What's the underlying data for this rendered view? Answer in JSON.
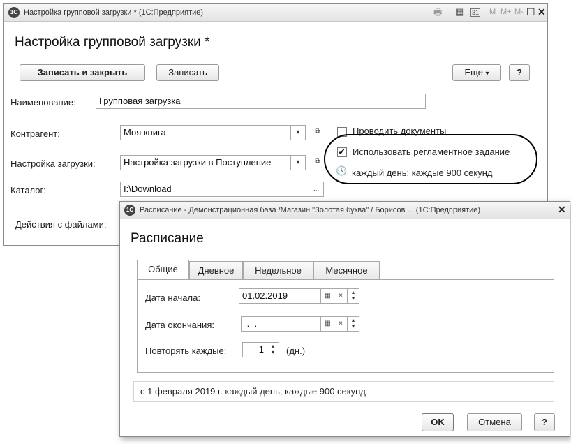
{
  "main_window": {
    "titlebar_text": "Настройка групповой загрузки * (1С:Предприятие)",
    "logo_text": "1С",
    "titlebar_icons": {
      "print": "🖶",
      "calc": "▦",
      "calendar": "31",
      "m": "M",
      "mplus": "M+",
      "mminus": "M-",
      "restore": "☐",
      "close": "✕"
    },
    "form_title": "Настройка групповой загрузки *",
    "buttons": {
      "save_close": "Записать и закрыть",
      "save": "Записать",
      "more": "Еще",
      "more_arrow": "▾",
      "help": "?"
    },
    "name_label": "Наименование:",
    "name_value": "Групповая загрузка",
    "counterparty_label": "Контрагент:",
    "counterparty_value": "Моя книга",
    "load_setting_label": "Настройка загрузки:",
    "load_setting_value": "Настройка загрузки в Поступление",
    "catalog_label": "Каталог:",
    "catalog_value": "I:\\Download",
    "file_actions_label": "Действия с файлами:",
    "dropdown_glyph": "▾",
    "open_glyph": "⧉",
    "ellipsis_glyph": "...",
    "post_docs_label": "Проводить документы",
    "post_docs_checked": false,
    "use_job_label": "Использовать регламентное задание",
    "use_job_checked": true,
    "check_glyph": "✓",
    "clock_glyph": "🕓",
    "schedule_link": "каждый день; каждые 900 секунд"
  },
  "schedule_window": {
    "titlebar_text": "Расписание - Демонстрационная база /Магазин \"Золотая буква\" / Борисов ... (1С:Предприятие)",
    "logo_text": "1С",
    "close_glyph": "✕",
    "form_title": "Расписание",
    "tabs": [
      {
        "label": "Общие",
        "active": true
      },
      {
        "label": "Дневное",
        "active": false
      },
      {
        "label": "Недельное",
        "active": false
      },
      {
        "label": "Месячное",
        "active": false
      }
    ],
    "start_date_label": "Дата начала:",
    "start_date_value": "01.02.2019",
    "end_date_label": "Дата окончания:",
    "end_date_value": " .  .",
    "calendar_glyph": "▦",
    "clear_glyph": "×",
    "spin_up": "▴",
    "spin_down": "▾",
    "repeat_label": "Повторять каждые:",
    "repeat_value": "1",
    "repeat_unit": "(дн.)",
    "summary": "с 1 февраля 2019 г. каждый день; каждые 900 секунд",
    "buttons": {
      "ok": "OK",
      "cancel": "Отмена",
      "help": "?"
    }
  }
}
